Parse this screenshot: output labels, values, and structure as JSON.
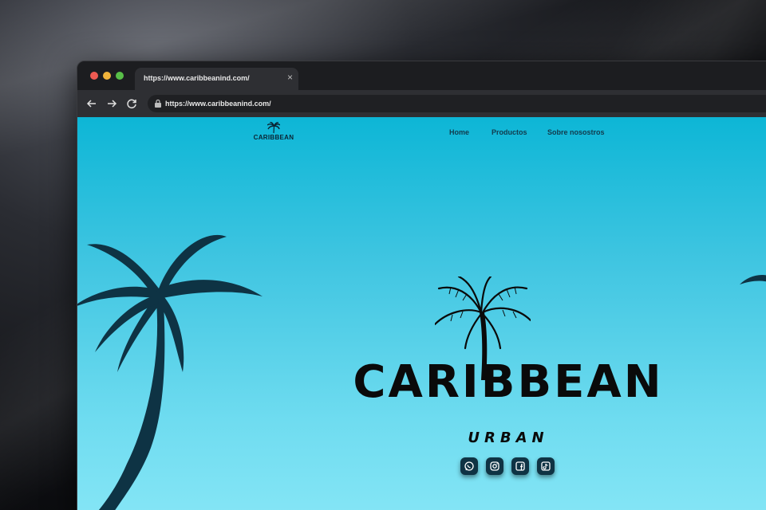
{
  "browser": {
    "tab_title": "https://www.caribbeanind.com/",
    "tab_close": "×",
    "url": "https://www.caribbeanind.com/"
  },
  "site": {
    "logo_text": "CARIBBEAN",
    "nav": [
      "Home",
      "Productos",
      "Sobre nosostros"
    ],
    "hero_title": "CARIBBEAN",
    "hero_subtitle": "URBAN",
    "social": [
      "whatsapp-icon",
      "instagram-icon",
      "facebook-icon",
      "tiktok-icon"
    ]
  },
  "colors": {
    "sky_top": "#0db6d6",
    "sky_bottom": "#86e6f6",
    "palm_silhouette": "#0e3344",
    "chrome": "#2e2f33"
  }
}
